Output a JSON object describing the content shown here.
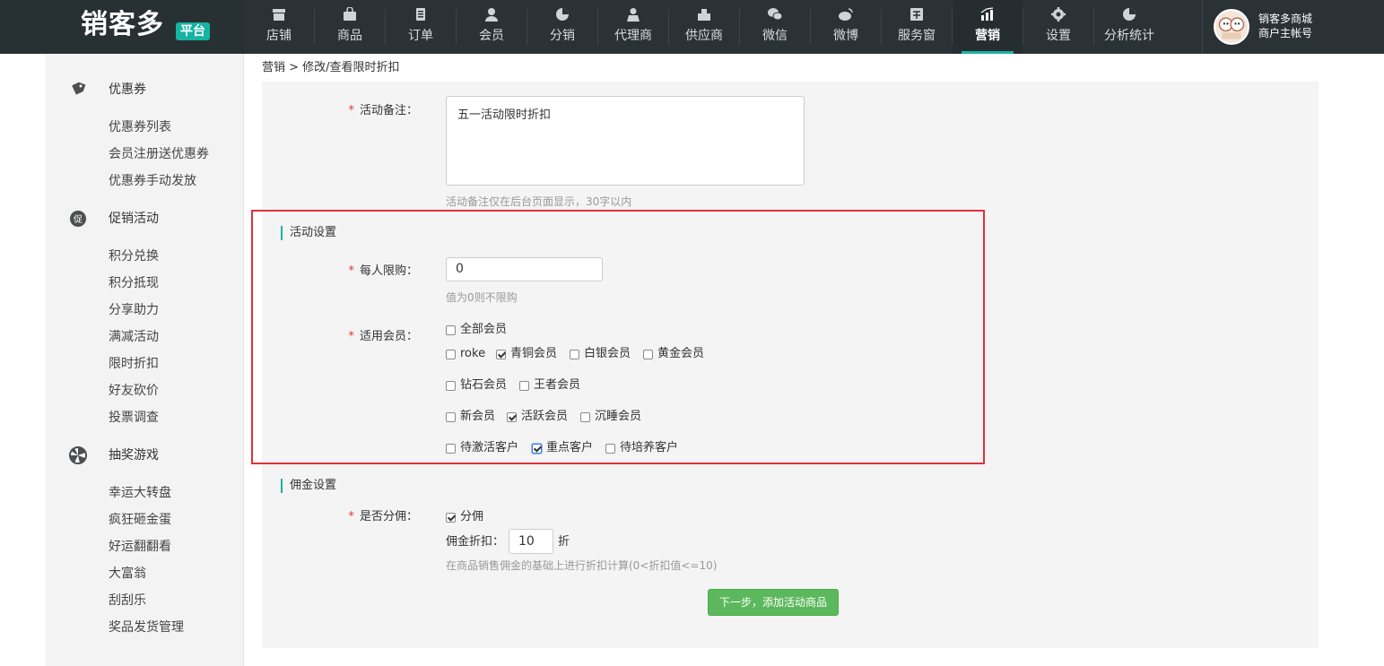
{
  "brand": {
    "logo_text": "销客多",
    "badge": "平台"
  },
  "nav": [
    {
      "label": "店铺",
      "icon": "store-icon"
    },
    {
      "label": "商品",
      "icon": "bag-icon"
    },
    {
      "label": "订单",
      "icon": "order-icon"
    },
    {
      "label": "会员",
      "icon": "member-icon"
    },
    {
      "label": "分销",
      "icon": "pie-icon"
    },
    {
      "label": "代理商",
      "icon": "agent-icon"
    },
    {
      "label": "供应商",
      "icon": "supplier-icon"
    },
    {
      "label": "微信",
      "icon": "wechat-icon"
    },
    {
      "label": "微博",
      "icon": "weibo-icon"
    },
    {
      "label": "服务窗",
      "icon": "service-window-icon"
    },
    {
      "label": "营销",
      "icon": "marketing-chart-icon",
      "active": true
    },
    {
      "label": "设置",
      "icon": "gear-icon"
    },
    {
      "label": "分析统计",
      "icon": "analytics-icon"
    }
  ],
  "user": {
    "line1": "销客多商城",
    "line2": "商户主帐号"
  },
  "sidebar": {
    "groups": [
      {
        "title": "优惠券",
        "icon": "coupon-tag-icon",
        "items": [
          "优惠券列表",
          "会员注册送优惠券",
          "优惠券手动发放"
        ]
      },
      {
        "title": "促销活动",
        "icon": "promotion-icon",
        "items": [
          "积分兑换",
          "积分抵现",
          "分享助力",
          "满减活动",
          "限时折扣",
          "好友砍价",
          "投票调查"
        ]
      },
      {
        "title": "抽奖游戏",
        "icon": "wheel-icon",
        "items": [
          "幸运大转盘",
          "疯狂砸金蛋",
          "好运翻翻看",
          "大富翁",
          "刮刮乐",
          "奖品发货管理"
        ]
      }
    ]
  },
  "breadcrumb": "营销 > 修改/查看限时折扣",
  "form": {
    "remark_label": "活动备注：",
    "remark_value": "五一活动限时折扣",
    "remark_hint": "活动备注仅在后台页面显示，30字以内",
    "section_activity": "活动设置",
    "limit_label": "每人限购：",
    "limit_value": "0",
    "limit_hint": "值为0则不限购",
    "members_label": "适用会员：",
    "members_all": "全部会员",
    "member_rows": [
      [
        {
          "label": "roke",
          "checked": false
        },
        {
          "label": "青铜会员",
          "checked": true
        },
        {
          "label": "白银会员",
          "checked": false
        },
        {
          "label": "黄金会员",
          "checked": false
        }
      ],
      [
        {
          "label": "钻石会员",
          "checked": false
        },
        {
          "label": "王者会员",
          "checked": false
        }
      ],
      [
        {
          "label": "新会员",
          "checked": false
        },
        {
          "label": "活跃会员",
          "checked": true
        },
        {
          "label": "沉睡会员",
          "checked": false
        }
      ],
      [
        {
          "label": "待激活客户",
          "checked": false
        },
        {
          "label": "重点客户",
          "checked": true
        },
        {
          "label": "待培养客户",
          "checked": false
        }
      ]
    ],
    "section_commission": "佣金设置",
    "commission_label": "是否分佣：",
    "commission_check_label": "分佣",
    "commission_discount_label": "佣金折扣：",
    "commission_discount_value": "10",
    "commission_unit": "折",
    "commission_hint": "在商品销售佣金的基础上进行折扣计算(0<折扣值<=10)",
    "next_button": "下一步，添加活动商品"
  },
  "colors": {
    "accent": "#17b3a3",
    "topbar": "#2b3236",
    "highlight": "#e0313b",
    "button": "#5cb85c",
    "required": "#e53333"
  }
}
